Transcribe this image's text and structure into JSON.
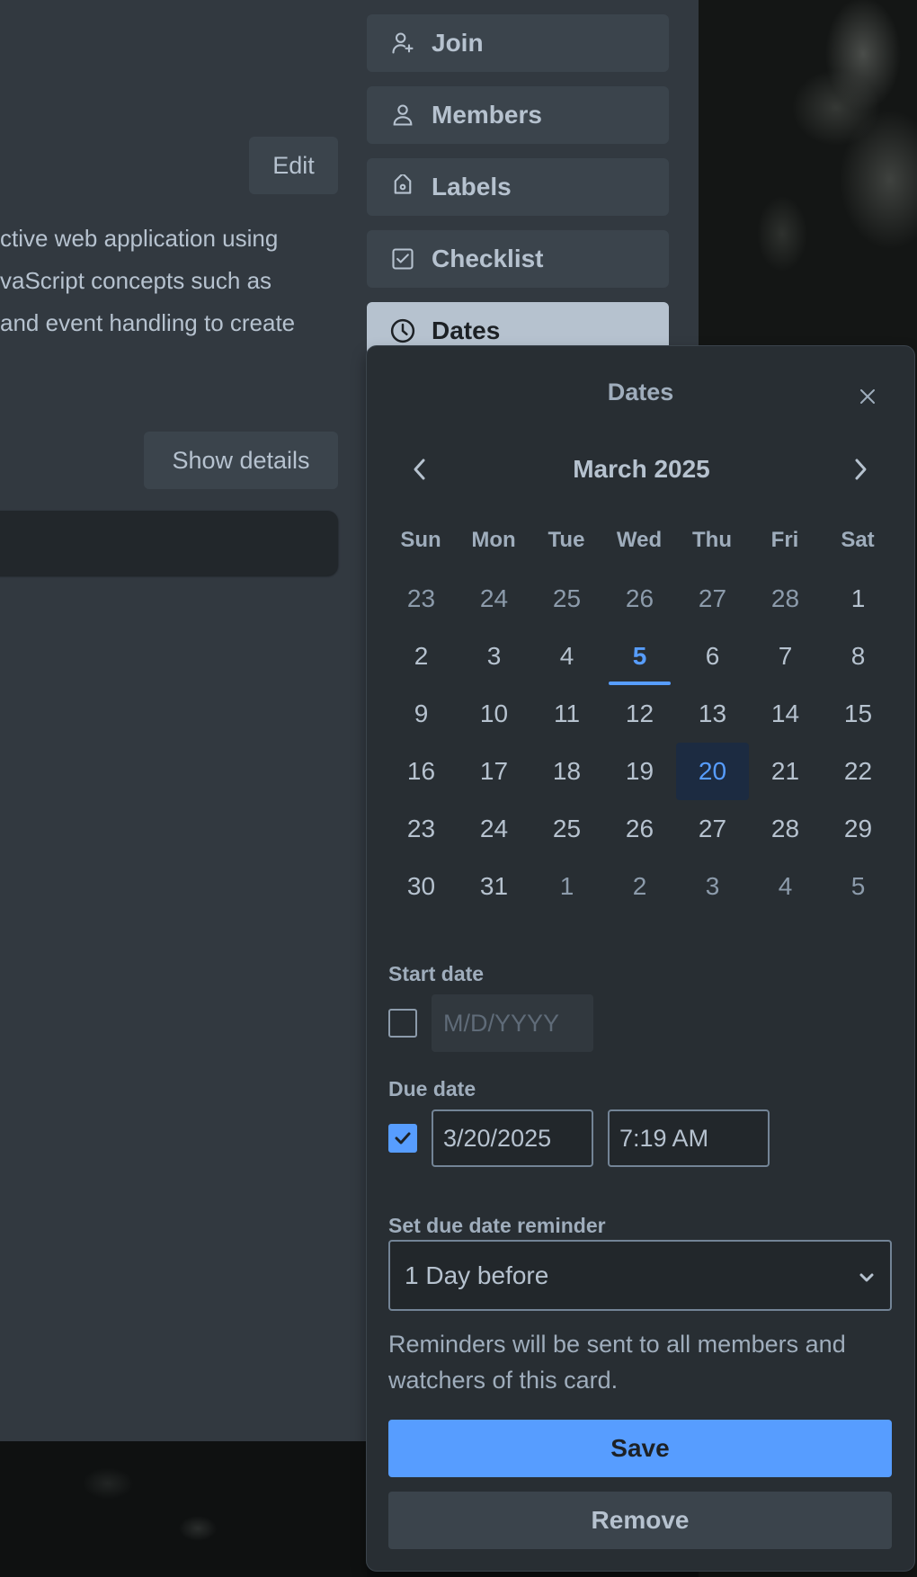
{
  "card": {
    "edit_label": "Edit",
    "description_lines": [
      "ctive web application using",
      "vaScript concepts such as",
      "and event handling to create"
    ],
    "show_details_label": "Show details"
  },
  "sidebar": {
    "items": [
      {
        "label": "Join",
        "icon": "user-plus-icon"
      },
      {
        "label": "Members",
        "icon": "user-icon"
      },
      {
        "label": "Labels",
        "icon": "tag-icon"
      },
      {
        "label": "Checklist",
        "icon": "checklist-icon"
      },
      {
        "label": "Dates",
        "icon": "clock-icon",
        "active": true
      }
    ]
  },
  "dates_popover": {
    "title": "Dates",
    "close_icon": "close-icon",
    "month_label": "March 2025",
    "weekdays": [
      "Sun",
      "Mon",
      "Tue",
      "Wed",
      "Thu",
      "Fri",
      "Sat"
    ],
    "weeks": [
      [
        "23",
        "24",
        "25",
        "26",
        "27",
        "28",
        "1"
      ],
      [
        "2",
        "3",
        "4",
        "5",
        "6",
        "7",
        "8"
      ],
      [
        "9",
        "10",
        "11",
        "12",
        "13",
        "14",
        "15"
      ],
      [
        "16",
        "17",
        "18",
        "19",
        "20",
        "21",
        "22"
      ],
      [
        "23",
        "24",
        "25",
        "26",
        "27",
        "28",
        "29"
      ],
      [
        "30",
        "31",
        "1",
        "2",
        "3",
        "4",
        "5"
      ]
    ],
    "today": "5",
    "selected": "20",
    "start_date": {
      "label": "Start date",
      "checked": false,
      "placeholder": "M/D/YYYY"
    },
    "due_date": {
      "label": "Due date",
      "checked": true,
      "date_value": "3/20/2025",
      "time_value": "7:19 AM"
    },
    "reminder": {
      "label": "Set due date reminder",
      "selected": "1 Day before",
      "note": "Reminders will be sent to all members and watchers of this card."
    },
    "save_label": "Save",
    "remove_label": "Remove"
  },
  "colors": {
    "accent": "#579dff",
    "panel": "#323940",
    "popover": "#282e33",
    "button": "#3b444c",
    "text": "#b6c2cf"
  }
}
